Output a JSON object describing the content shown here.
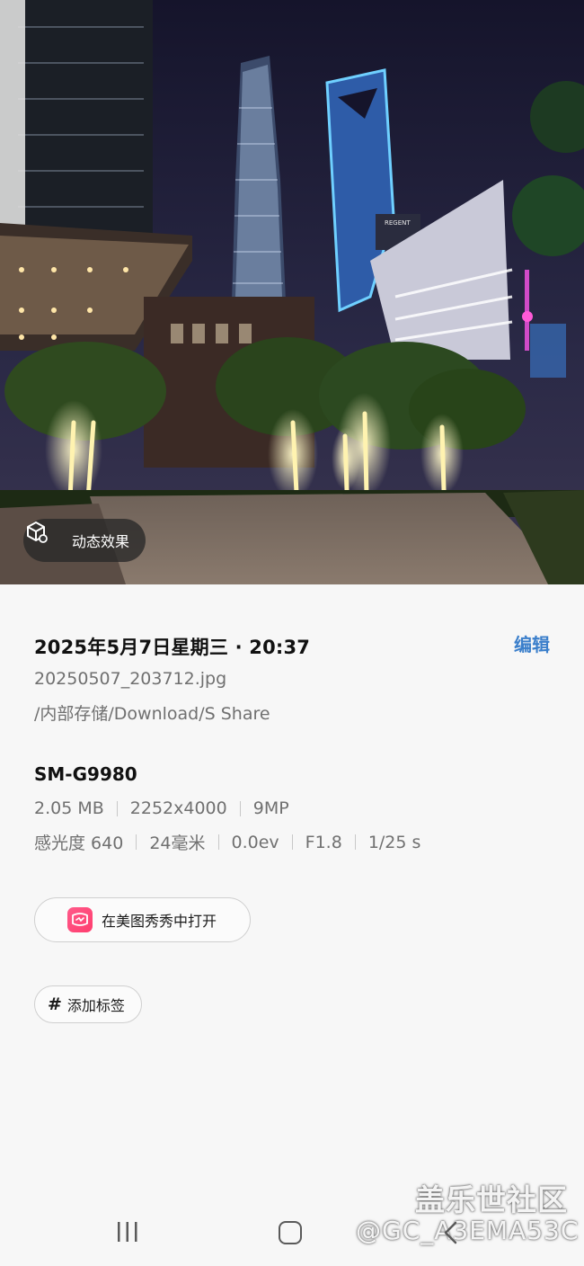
{
  "photo": {
    "motion_label": "动态效果",
    "building_sign": "REGENT"
  },
  "info": {
    "date_time": "2025年5月7日星期三 · 20:37",
    "edit_label": "编辑",
    "filename": "20250507_203712.jpg",
    "path": "/内部存储/Download/S Share",
    "device_model": "SM-G9980",
    "file_size": "2.05 MB",
    "resolution": "2252x4000",
    "megapixels": "9MP",
    "iso": "感光度 640",
    "focal_length": "24毫米",
    "exposure": "0.0ev",
    "aperture": "F1.8",
    "shutter": "1/25 s",
    "open_with_label": "在美图秀秀中打开",
    "add_tag_label": "添加标签"
  },
  "watermark": {
    "site": "盖乐世社区",
    "user": "@GC_A3EMA53C"
  },
  "colors": {
    "accent": "#3b7fcb",
    "meitu_icon": "#ff4d7a"
  },
  "nav": {
    "icons": [
      "recent-apps-icon",
      "home-icon",
      "back-icon"
    ]
  }
}
